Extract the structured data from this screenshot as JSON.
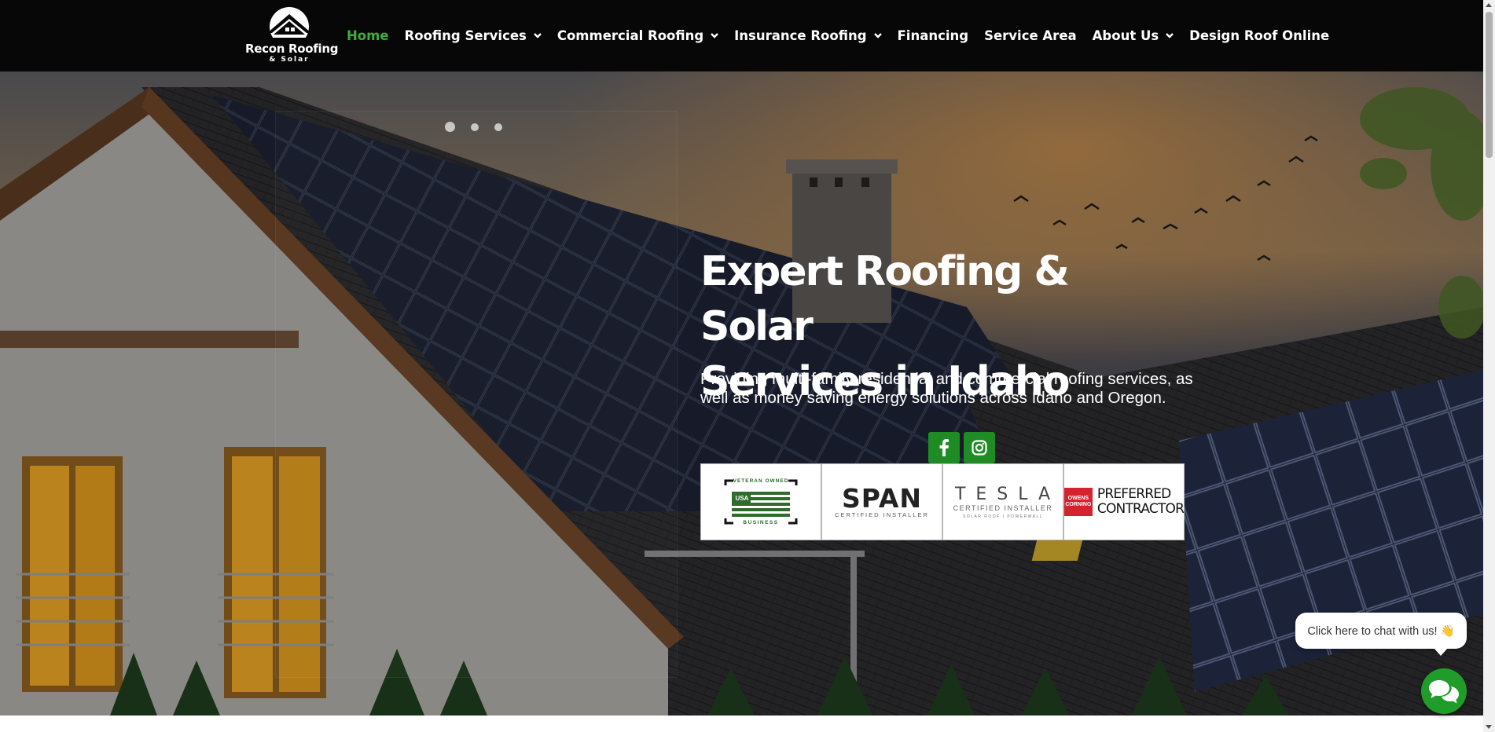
{
  "header": {
    "logo": {
      "name": "Recon Roofing",
      "sub": "& Solar"
    },
    "nav": [
      {
        "label": "Home",
        "active": true,
        "dropdown": false
      },
      {
        "label": "Roofing Services",
        "active": false,
        "dropdown": true
      },
      {
        "label": "Commercial Roofing",
        "active": false,
        "dropdown": true
      },
      {
        "label": "Insurance Roofing",
        "active": false,
        "dropdown": true
      },
      {
        "label": "Financing",
        "active": false,
        "dropdown": false
      },
      {
        "label": "Service Area",
        "active": false,
        "dropdown": false
      },
      {
        "label": "About Us",
        "active": false,
        "dropdown": true
      },
      {
        "label": "Design Roof Online",
        "active": false,
        "dropdown": false
      }
    ]
  },
  "hero": {
    "title_line1": "Expert Roofing & Solar",
    "title_line2": "Services in Idaho",
    "text": "Providing multi-family residential and commercial roofing services, as well as money saving energy solutions across Idaho and Oregon.",
    "slider": {
      "total": 3,
      "current": 1
    },
    "social": [
      {
        "icon": "facebook-icon"
      },
      {
        "icon": "instagram-icon"
      }
    ],
    "badges": {
      "veteran": {
        "top": "VETERAN OWNED",
        "flag": "USA",
        "bottom": "BUSINESS"
      },
      "span": {
        "word": "SPAN",
        "sub": "CERTIFIED INSTALLER"
      },
      "tesla": {
        "word": "TESLA",
        "sub": "CERTIFIED INSTALLER",
        "sub2": "SOLAR ROOF | POWERWALL"
      },
      "owens": {
        "logo_line1": "OWENS",
        "logo_line2": "CORNING",
        "line1": "PREFERRED",
        "line2": "CONTRACTOR"
      }
    }
  },
  "chat": {
    "prompt": "Click here to chat with us! 👋"
  },
  "colors": {
    "accent": "#3fae3a",
    "social_bg": "#1e8b24",
    "chat_bg": "#1f9c2a",
    "header_bg": "#070707"
  }
}
